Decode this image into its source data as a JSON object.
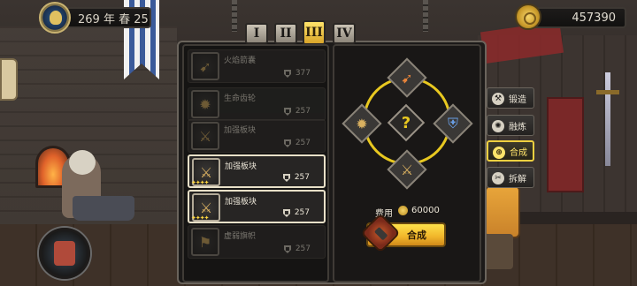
{
  "hud": {
    "date": "269 年 春 25",
    "gold": "457390"
  },
  "tiers": [
    "I",
    "II",
    "III",
    "IV"
  ],
  "active_tier": "III",
  "items": [
    {
      "name": "火焰箭囊",
      "count": "377",
      "stars": "",
      "state": "dim",
      "icon": "fire-arrow-icon"
    },
    {
      "name": "生命齿轮",
      "count": "257",
      "stars": "",
      "state": "dim",
      "icon": "life-gear-icon"
    },
    {
      "name": "加强板块",
      "count": "257",
      "stars": "",
      "state": "dim",
      "icon": "armor-plate-icon"
    },
    {
      "name": "加强板块",
      "count": "257",
      "stars": "✦✦✦✦",
      "state": "active",
      "icon": "armor-plate-icon"
    },
    {
      "name": "加强板块",
      "count": "257",
      "stars": "✦✦✦✦",
      "state": "active",
      "icon": "armor-plate-icon"
    },
    {
      "name": "虚弱旗帜",
      "count": "257",
      "stars": "",
      "state": "dim",
      "icon": "weak-flag-icon"
    }
  ],
  "recipe": {
    "result_placeholder": "?",
    "cost_label": "费用",
    "cost_value": "60000",
    "craft_label": "合成"
  },
  "side_menu": [
    {
      "label": "锻造",
      "icon": "forge-icon",
      "glyph": "⚒",
      "active": false
    },
    {
      "label": "融炼",
      "icon": "smelt-icon",
      "glyph": "✺",
      "active": false
    },
    {
      "label": "合成",
      "icon": "combine-icon",
      "glyph": "⊕",
      "active": true
    },
    {
      "label": "拆解",
      "icon": "disassemble-icon",
      "glyph": "✂",
      "active": false
    }
  ],
  "colors": {
    "accent": "#e8c820",
    "button": "#f0b52a",
    "panel": "#1c1a19"
  }
}
